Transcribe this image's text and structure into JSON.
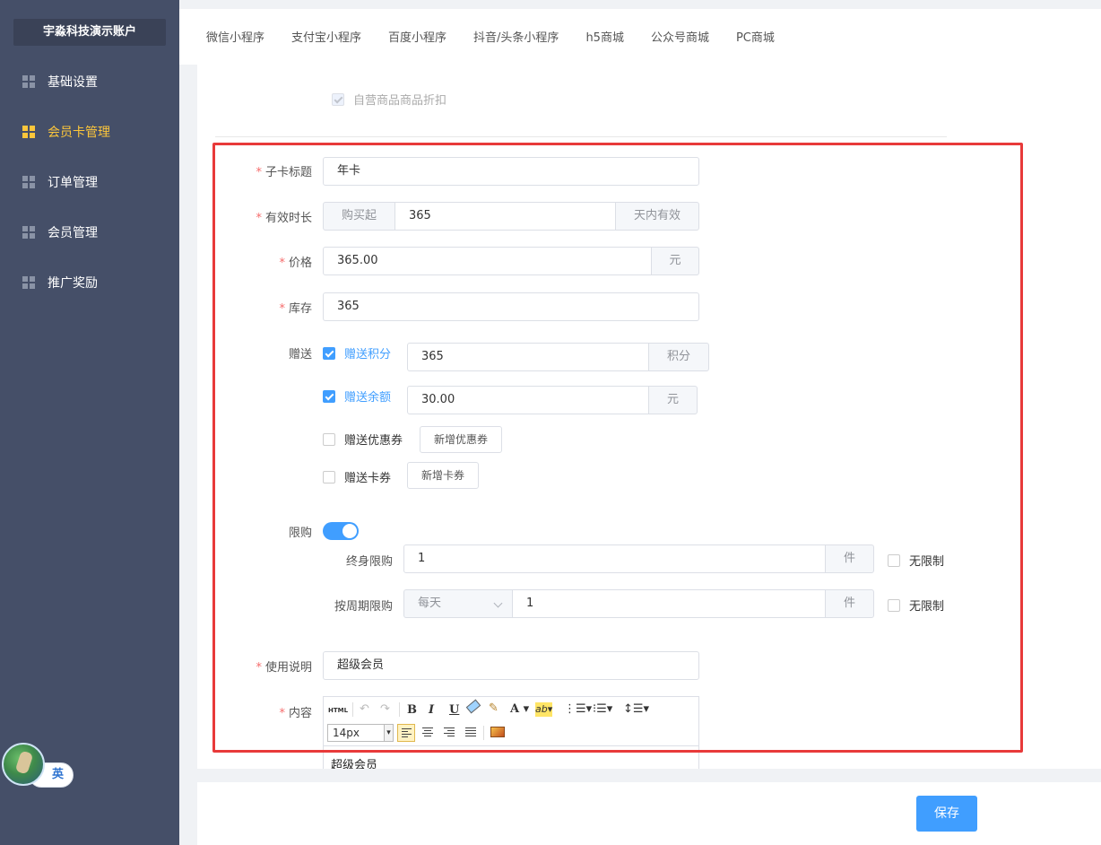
{
  "sidebar": {
    "account": "宇淼科技演示账户",
    "items": [
      {
        "label": "基础设置"
      },
      {
        "label": "会员卡管理"
      },
      {
        "label": "订单管理"
      },
      {
        "label": "会员管理"
      },
      {
        "label": "推广奖励"
      }
    ],
    "active_index": 1,
    "lang_pill": "英"
  },
  "tabs": [
    "微信小程序",
    "支付宝小程序",
    "百度小程序",
    "抖音/头条小程序",
    "h5商城",
    "公众号商城",
    "PC商城"
  ],
  "discount_option": {
    "label": "自营商品商品折扣",
    "checked": true,
    "disabled": true
  },
  "form": {
    "title": {
      "label": "子卡标题",
      "value": "年卡"
    },
    "duration": {
      "label": "有效时长",
      "prefix": "购买起",
      "value": "365",
      "suffix": "天内有效"
    },
    "price": {
      "label": "价格",
      "value": "365.00",
      "suffix": "元"
    },
    "stock": {
      "label": "库存",
      "value": "365"
    },
    "gift": {
      "label": "赠送",
      "points": {
        "label": "赠送积分",
        "checked": true,
        "value": "365",
        "suffix": "积分"
      },
      "balance": {
        "label": "赠送余额",
        "checked": true,
        "value": "30.00",
        "suffix": "元"
      },
      "coupon": {
        "label": "赠送优惠券",
        "checked": false,
        "button": "新增优惠券"
      },
      "card": {
        "label": "赠送卡券",
        "checked": false,
        "button": "新增卡券"
      }
    },
    "limit": {
      "label": "限购",
      "enabled": true,
      "lifetime": {
        "label": "终身限购",
        "value": "1",
        "suffix": "件",
        "unlimited_label": "无限制",
        "unlimited": false
      },
      "period": {
        "label": "按周期限购",
        "period_value": "每天",
        "value": "1",
        "suffix": "件",
        "unlimited_label": "无限制",
        "unlimited": false
      }
    },
    "usage": {
      "label": "使用说明",
      "value": "超级会员"
    },
    "content": {
      "label": "内容",
      "font_size": "14px",
      "body": "超级会员"
    }
  },
  "editor_tools": [
    "html-icon",
    "undo-icon",
    "redo-icon",
    "bold-icon",
    "italic-icon",
    "underline-icon",
    "eraser-icon",
    "format-brush-icon",
    "font-color-icon",
    "highlight-icon",
    "ordered-list-icon",
    "unordered-list-icon",
    "line-height-icon",
    "align-left-icon",
    "align-center-icon",
    "align-right-icon",
    "align-justify-icon",
    "image-icon"
  ],
  "colors": {
    "primary": "#409eff",
    "sidebar_bg": "#454f68",
    "active_nav": "#fcc63b",
    "required": "#f56c6c",
    "highlight_border": "#e83a3a"
  },
  "footer": {
    "save_label": "保存"
  }
}
